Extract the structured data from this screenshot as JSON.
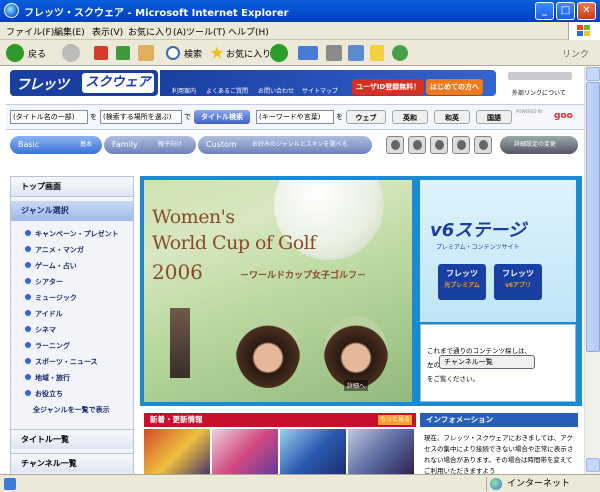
{
  "window": {
    "title": "フレッツ・スクウェア - Microsoft Internet Explorer",
    "min": "_",
    "max": "□",
    "close": "✕"
  },
  "menu": [
    "ファイル(F)",
    "編集(E)",
    "表示(V)",
    "お気に入り(A)",
    "ツール(T)",
    "ヘルプ(H)"
  ],
  "toolbar": {
    "back": "戻る",
    "search": "検索",
    "favorites": "お気に入り",
    "links": "リンク"
  },
  "status": {
    "zone": "インターネット"
  },
  "header": {
    "logo_a": "フレッツ",
    "logo_b": "スクウェア",
    "links": [
      "利用案内",
      "よくあるご質問",
      "お問い合わせ",
      "サイトマップ"
    ],
    "register": "ユーザID登録無料！",
    "first_time": "はじめての方へ",
    "external": "外部リンクについて"
  },
  "search": {
    "title_placeholder": "(タイトル名の一部)",
    "in1": "を",
    "area_select": "(検索する場所を選ぶ)",
    "in2": "で",
    "title_search": "タイトル検索",
    "keyword_placeholder": "(キーワードや言葉)",
    "in3": "を",
    "web": "ウェブ",
    "en_ja": "英和",
    "ja_en": "和英",
    "dict": "国語",
    "powered": "POWERED BY",
    "goo": "goo"
  },
  "modes": {
    "basic": "Basic",
    "basic_sub": "基本",
    "family": "Family",
    "family_sub": "親子向け",
    "custom": "Custom",
    "custom_sub": "お好みのジャンルとスキンを選べる",
    "settings": "詳細設定の変更"
  },
  "sidebar": {
    "top": "トップ画面",
    "genre": "ジャンル選択",
    "items": [
      "キャンペーン・プレゼント",
      "アニメ・マンガ",
      "ゲーム・占い",
      "シアター",
      "ミュージック",
      "アイドル",
      "シネマ",
      "ラーニング",
      "スポーツ・ニュース",
      "地域・旅行",
      "お役立ち"
    ],
    "all": "全ジャンルを一覧で表示",
    "title_list": "タイトル一覧",
    "channel_list": "チャンネル一覧"
  },
  "banner": {
    "line1": "Women's",
    "line2": "World Cup of Golf",
    "line3": "2006",
    "jp": "－ワールドカップ女子ゴルフ－",
    "more": "詳細へ"
  },
  "v6": {
    "logo": "v6ステージ",
    "sub": "プレミアム・コンテンツサイト",
    "btn1": "フレッツ",
    "btn1_sub": "光プレミアム",
    "btn2": "フレッツ",
    "btn2_sub": "v6アプリ"
  },
  "channel": {
    "l1": "これまで通りのコンテンツ探しは、",
    "l2": "左の",
    "button": "チャンネル一覧",
    "l3": "をご覧ください。"
  },
  "news": {
    "title": "新着・更新情報",
    "more": "もっと見る"
  },
  "info": {
    "title": "インフォメーション",
    "text": "現在、フレッツ・スクウェアにおきましては、アクセスの集中により接続できない場合や正常に表示されない場合があります。その場合は時間帯を変えてご利用いただきますよう"
  },
  "colors": {
    "titlebar": "#0450d0",
    "brand": "#1a3fa2",
    "news": "#c8102e",
    "info": "#2a5fb8",
    "banner": "#1a8ad4"
  }
}
